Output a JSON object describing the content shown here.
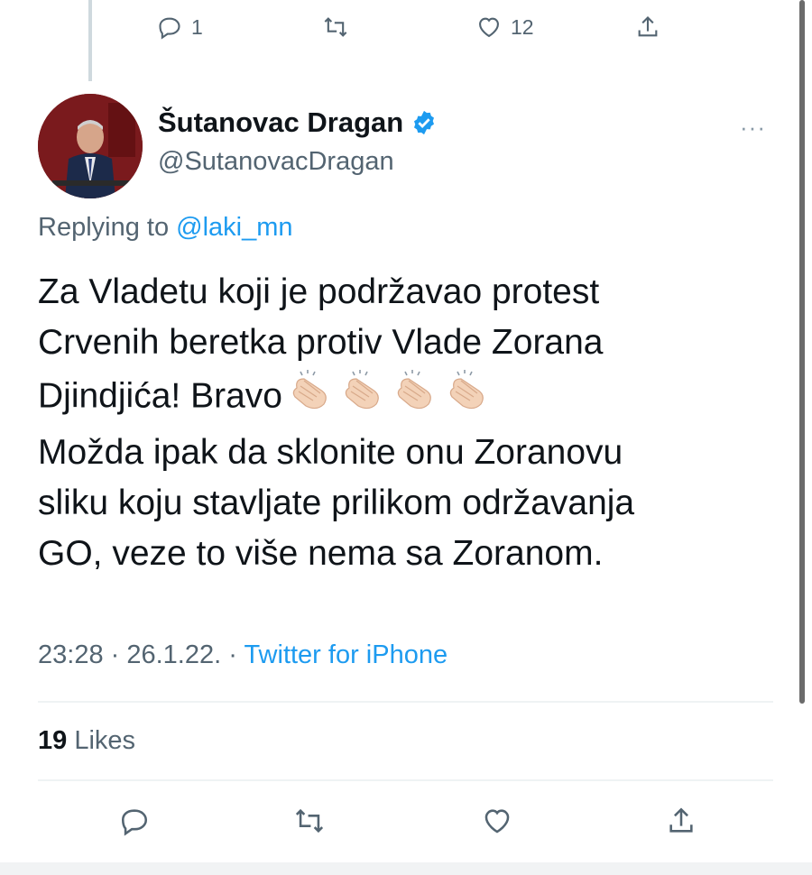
{
  "previous_tweet_actions": {
    "reply_count": "1",
    "retweet_count": "",
    "like_count": "12",
    "icons": [
      "reply-icon",
      "retweet-icon",
      "like-icon",
      "share-icon"
    ]
  },
  "author": {
    "display_name": "Šutanovac Dragan",
    "handle": "@SutanovacDragan",
    "verified": true
  },
  "more_menu": "···",
  "reply": {
    "prefix": "Replying to ",
    "mention": "@laki_mn"
  },
  "tweet": {
    "lines": [
      "Za Vladetu koji je podržavao protest",
      "Crvenih beretka protiv Vlade Zorana",
      "Djindjića! Bravo",
      "Možda ipak da sklonite onu Zoranovu",
      "sliku koju stavljate prilikom održavanja",
      "GO, veze to više nema sa Zoranom."
    ],
    "emoji_after_line_3": "👏🏻👏🏻👏🏻👏🏻"
  },
  "meta": {
    "time": "23:28",
    "sep1": " · ",
    "date": "26.1.22.",
    "sep2": " · ",
    "source": "Twitter for iPhone"
  },
  "likes": {
    "count": "19",
    "label": " Likes"
  },
  "colors": {
    "accent": "#1d9bf0",
    "secondary_text": "#536471",
    "primary_text": "#0f1419",
    "divider": "#eff3f4"
  }
}
